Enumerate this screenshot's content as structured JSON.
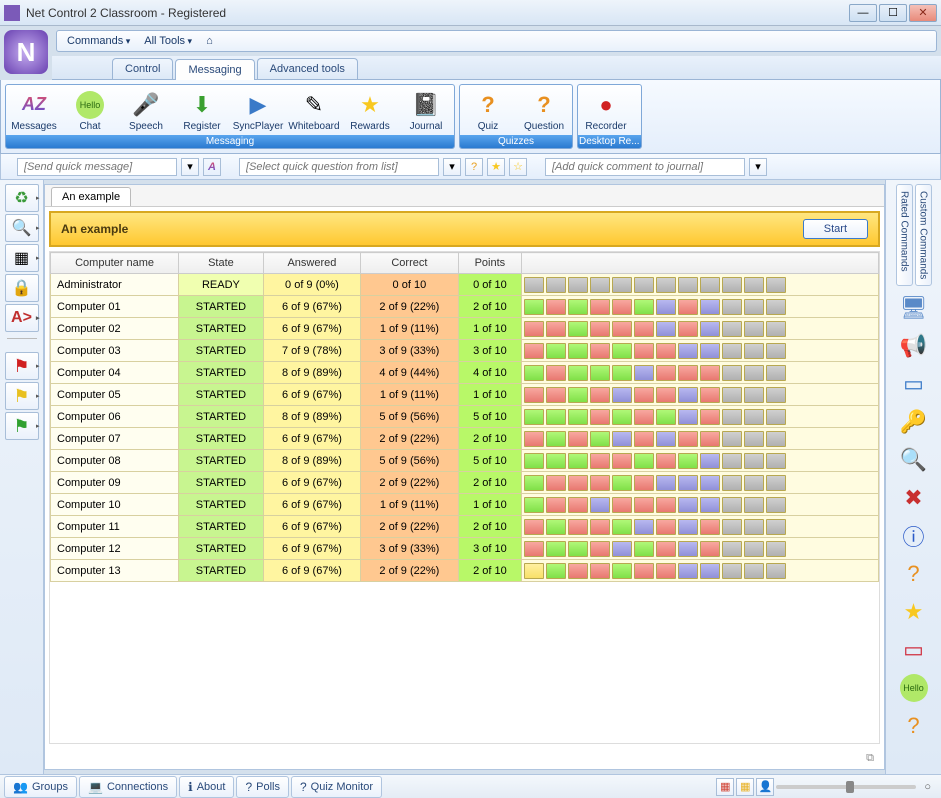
{
  "window": {
    "title": "Net Control 2 Classroom - Registered"
  },
  "menubar": {
    "commands": "Commands",
    "all_tools": "All Tools"
  },
  "tabs": {
    "control": "Control",
    "messaging": "Messaging",
    "advanced": "Advanced tools"
  },
  "ribbon": {
    "messaging": {
      "label": "Messaging",
      "items": [
        {
          "label": "Messages",
          "icon": "AZ"
        },
        {
          "label": "Chat",
          "icon": "Hello"
        },
        {
          "label": "Speech",
          "icon": "🎤"
        },
        {
          "label": "Register",
          "icon": "⬇"
        },
        {
          "label": "SyncPlayer",
          "icon": "▶"
        },
        {
          "label": "Whiteboard",
          "icon": "✎"
        },
        {
          "label": "Rewards",
          "icon": "★"
        },
        {
          "label": "Journal",
          "icon": "📓"
        }
      ]
    },
    "quizzes": {
      "label": "Quizzes",
      "items": [
        {
          "label": "Quiz",
          "icon": "?"
        },
        {
          "label": "Question",
          "icon": "?"
        }
      ]
    },
    "desktop": {
      "label": "Desktop Re...",
      "items": [
        {
          "label": "Recorder",
          "icon": "●"
        }
      ]
    }
  },
  "quickbar": {
    "send_msg": "[Send quick message]",
    "select_q": "[Select quick question from list]",
    "add_comment": "[Add quick comment to journal]"
  },
  "panel": {
    "tab": "An example",
    "title": "An example",
    "start": "Start",
    "columns": [
      "Computer name",
      "State",
      "Answered",
      "Correct",
      "Points",
      ""
    ],
    "rows": [
      {
        "name": "Administrator",
        "state": "READY",
        "answered": "0 of 9 (0%)",
        "correct": "0 of 10",
        "points": "0 of 10",
        "dots": "xxxxxxxxxxxx"
      },
      {
        "name": "Computer 01",
        "state": "STARTED",
        "answered": "6 of 9 (67%)",
        "correct": "2 of 9 (22%)",
        "points": "2 of 10",
        "dots": "grgrrgbrbxxx"
      },
      {
        "name": "Computer 02",
        "state": "STARTED",
        "answered": "6 of 9 (67%)",
        "correct": "1 of 9 (11%)",
        "points": "1 of 10",
        "dots": "rrgrrrbrbxxx"
      },
      {
        "name": "Computer 03",
        "state": "STARTED",
        "answered": "7 of 9 (78%)",
        "correct": "3 of 9 (33%)",
        "points": "3 of 10",
        "dots": "rggrgrrbbxxx"
      },
      {
        "name": "Computer 04",
        "state": "STARTED",
        "answered": "8 of 9 (89%)",
        "correct": "4 of 9 (44%)",
        "points": "4 of 10",
        "dots": "grgggbrrrxxx"
      },
      {
        "name": "Computer 05",
        "state": "STARTED",
        "answered": "6 of 9 (67%)",
        "correct": "1 of 9 (11%)",
        "points": "1 of 10",
        "dots": "rrgrbrrbrxxx"
      },
      {
        "name": "Computer 06",
        "state": "STARTED",
        "answered": "8 of 9 (89%)",
        "correct": "5 of 9 (56%)",
        "points": "5 of 10",
        "dots": "gggrgrgbrxxx"
      },
      {
        "name": "Computer 07",
        "state": "STARTED",
        "answered": "6 of 9 (67%)",
        "correct": "2 of 9 (22%)",
        "points": "2 of 10",
        "dots": "rgrgbrbrrxxx"
      },
      {
        "name": "Computer 08",
        "state": "STARTED",
        "answered": "8 of 9 (89%)",
        "correct": "5 of 9 (56%)",
        "points": "5 of 10",
        "dots": "gggrrgrgbxxx"
      },
      {
        "name": "Computer 09",
        "state": "STARTED",
        "answered": "6 of 9 (67%)",
        "correct": "2 of 9 (22%)",
        "points": "2 of 10",
        "dots": "grrrgrbbbxxx"
      },
      {
        "name": "Computer 10",
        "state": "STARTED",
        "answered": "6 of 9 (67%)",
        "correct": "1 of 9 (11%)",
        "points": "1 of 10",
        "dots": "grrbrrrbbxxx"
      },
      {
        "name": "Computer 11",
        "state": "STARTED",
        "answered": "6 of 9 (67%)",
        "correct": "2 of 9 (22%)",
        "points": "2 of 10",
        "dots": "rgrrgbrbrxxx"
      },
      {
        "name": "Computer 12",
        "state": "STARTED",
        "answered": "6 of 9 (67%)",
        "correct": "3 of 9 (33%)",
        "points": "3 of 10",
        "dots": "rggrbgrbrxxx"
      },
      {
        "name": "Computer 13",
        "state": "STARTED",
        "answered": "6 of 9 (67%)",
        "correct": "2 of 9 (22%)",
        "points": "2 of 10",
        "dots": "ygrrgrrbbxxx"
      }
    ]
  },
  "right_tabs": {
    "rated": "Rated Commands",
    "custom": "Custom Commands"
  },
  "statusbar": {
    "tabs": [
      {
        "label": "Groups",
        "icon": "👥"
      },
      {
        "label": "Connections",
        "icon": "💻"
      },
      {
        "label": "About",
        "icon": "ℹ"
      },
      {
        "label": "Polls",
        "icon": "?"
      },
      {
        "label": "Quiz Monitor",
        "icon": "?"
      }
    ]
  }
}
